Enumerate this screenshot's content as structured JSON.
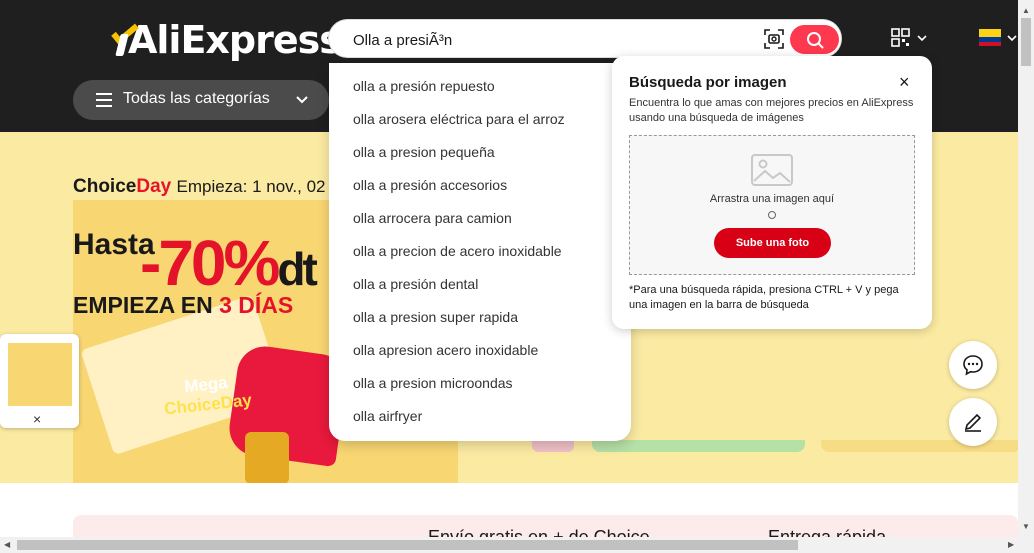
{
  "header": {
    "logo_text": "AliExpress",
    "search": {
      "value": "Olla a presiÃ³n"
    },
    "categories_label": "Todas las categorías"
  },
  "banner": {
    "choice_brand": "Choice",
    "choice_day": "Day",
    "choice_date": "Empieza: 1 nov., 02",
    "hasta": "Hasta",
    "discount": "-70%",
    "discount_suffix": "dt",
    "empieza_prefix": "EMPIEZA EN",
    "empieza_num": "3 DÍAS",
    "mega_line1": "Mega",
    "mega_line2": "ChoiceDay"
  },
  "float_box": {
    "close": "×"
  },
  "suggestions": [
    "olla a presión repuesto",
    "olla arosera eléctrica para el arroz",
    "olla a presion pequeña",
    "olla a presión accesorios",
    "olla arrocera para camion",
    "olla a precion de acero inoxidable",
    "olla a presión dental",
    "olla a presion super rapida",
    "olla apresion acero inoxidable",
    "olla a presion microondas",
    "olla airfryer"
  ],
  "image_search": {
    "title": "Búsqueda por imagen",
    "close": "×",
    "description": "Encuentra lo que amas con mejores precios en AliExpress usando una búsqueda de imágenes",
    "drag_text": "Arrastra una imagen aquí",
    "upload_label": "Sube una foto",
    "hint": "*Para una búsqueda rápida, presiona CTRL + V y pega una imagen en la barra de búsqueda"
  },
  "bottom_strip": {
    "text1": "Envío gratis en + de Choice",
    "text2": "Entrega rápida"
  },
  "colors": {
    "header_bg": "#1f1f1f",
    "search_button": "#fd384f",
    "upload_button": "#d70015",
    "accent_red": "#e5132a"
  },
  "icons": [
    "image-search-icon",
    "search-icon",
    "qr-code-icon",
    "chevron-down-icon",
    "colombia-flag-icon",
    "menu-icon",
    "image-placeholder-icon",
    "chat-icon",
    "edit-icon",
    "close-icon"
  ]
}
